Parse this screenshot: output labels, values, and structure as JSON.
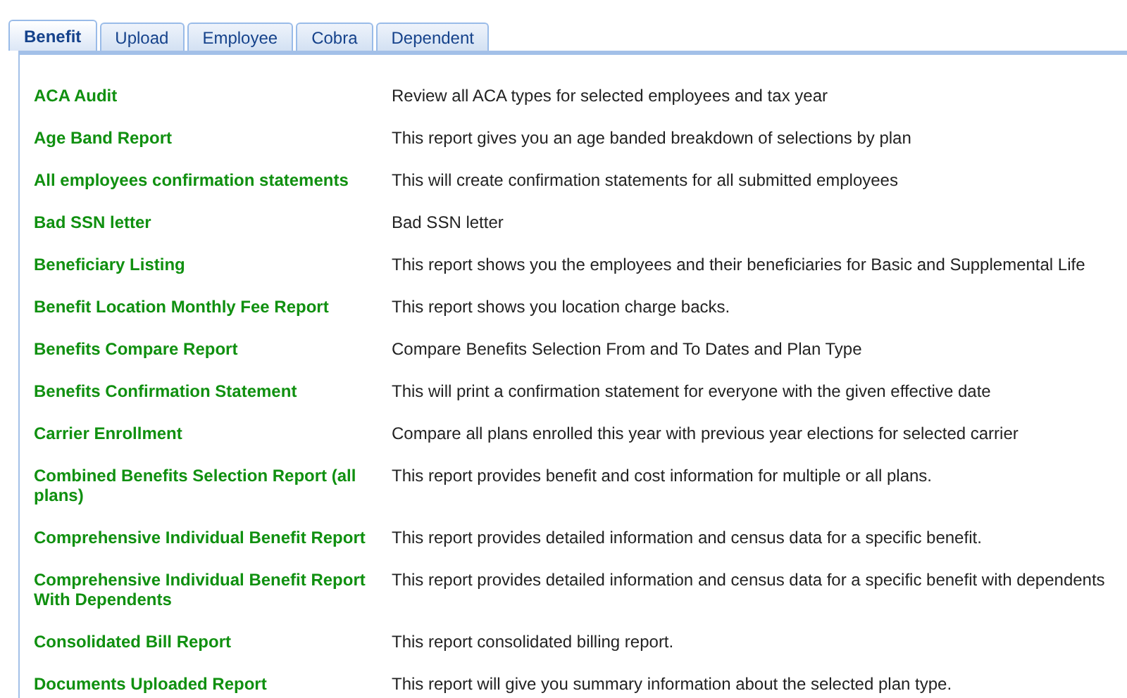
{
  "tabs": [
    {
      "label": "Benefit",
      "selected": true
    },
    {
      "label": "Upload",
      "selected": false
    },
    {
      "label": "Employee",
      "selected": false
    },
    {
      "label": "Cobra",
      "selected": false
    },
    {
      "label": "Dependent",
      "selected": false
    }
  ],
  "reports": [
    {
      "name": "ACA Audit",
      "description": "Review all ACA types for selected employees and tax year"
    },
    {
      "name": "Age Band Report",
      "description": "This report gives you an age banded breakdown of selections by plan"
    },
    {
      "name": "All employees confirmation statements",
      "description": "This will create confirmation statements for all submitted employees"
    },
    {
      "name": "Bad SSN letter",
      "description": "Bad SSN letter"
    },
    {
      "name": "Beneficiary Listing",
      "description": "This report shows you the employees and their beneficiaries for Basic and Supplemental Life"
    },
    {
      "name": "Benefit Location Monthly Fee Report",
      "description": "This report shows you location charge backs."
    },
    {
      "name": "Benefits Compare Report",
      "description": "Compare Benefits Selection From and To Dates and Plan Type"
    },
    {
      "name": "Benefits Confirmation Statement",
      "description": "This will print a confirmation statement for everyone with the given effective date"
    },
    {
      "name": "Carrier Enrollment",
      "description": "Compare all plans enrolled this year with previous year elections for selected carrier"
    },
    {
      "name": "Combined Benefits Selection Report (all plans)",
      "description": "This report provides benefit and cost information for multiple or all plans."
    },
    {
      "name": "Comprehensive Individual Benefit Report",
      "description": "This report provides detailed information and census data for a specific benefit."
    },
    {
      "name": "Comprehensive Individual Benefit Report With Dependents",
      "description": "This report provides detailed information and census data for a specific benefit with dependents"
    },
    {
      "name": "Consolidated Bill Report",
      "description": "This report consolidated billing report."
    },
    {
      "name": "Documents Uploaded Report",
      "description": "This report will give you summary information about the selected plan type."
    }
  ]
}
